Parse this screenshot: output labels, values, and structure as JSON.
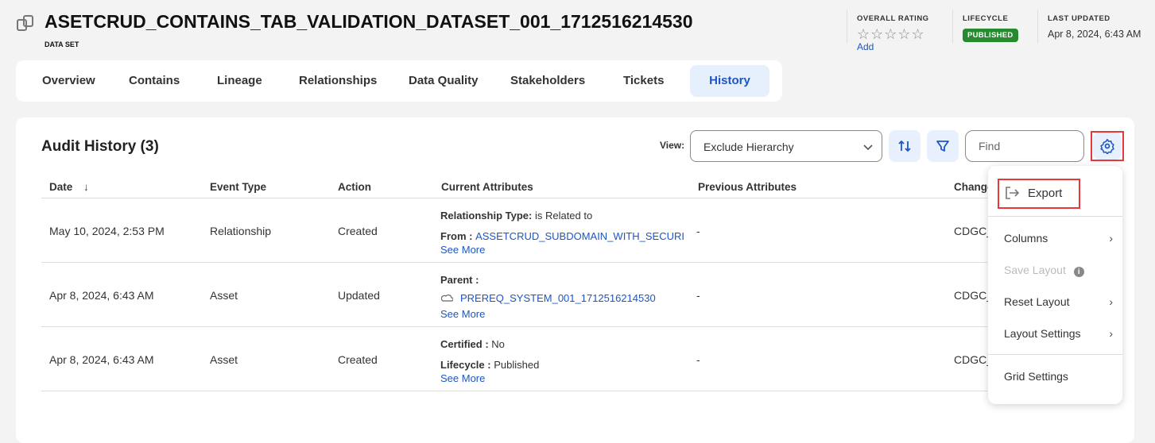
{
  "header": {
    "title": "ASETCRUD_CONTAINS_TAB_VALIDATION_DATASET_001_1712516214530",
    "subtitle": "DATA SET",
    "icon": "dataset-icon"
  },
  "meta": {
    "rating_label": "OVERALL RATING",
    "rating": 0,
    "rating_max": 5,
    "rating_add": "Add",
    "lifecycle_label": "LIFECYCLE",
    "lifecycle": "PUBLISHED",
    "lifecycle_color": "#268a2e",
    "updated_label": "LAST UPDATED",
    "updated": "Apr 8, 2024, 6:43 AM"
  },
  "tabs": [
    {
      "label": "Overview"
    },
    {
      "label": "Contains"
    },
    {
      "label": "Lineage"
    },
    {
      "label": "Relationships"
    },
    {
      "label": "Data Quality"
    },
    {
      "label": "Stakeholders"
    },
    {
      "label": "Tickets"
    },
    {
      "label": "History",
      "active": true
    }
  ],
  "audit": {
    "title": "Audit History (3)",
    "view_label": "View:",
    "view_value": "Exclude Hierarchy",
    "find_placeholder": "Find",
    "columns": [
      "Date",
      "Event Type",
      "Action",
      "Current Attributes",
      "Previous Attributes",
      "Change"
    ],
    "rows": [
      {
        "date": "May 10, 2024, 2:53 PM",
        "event": "Relationship",
        "action": "Created",
        "a1k": "Relationship Type",
        "a1v": "is Related to",
        "a2k": "From",
        "a2v": "ASSETCRUD_SUBDOMAIN_WITH_SECURI",
        "more": "See More",
        "prev": "-",
        "change": "CDGC_"
      },
      {
        "date": "Apr 8, 2024, 6:43 AM",
        "event": "Asset",
        "action": "Updated",
        "a1k": "Parent",
        "a2v": "PREREQ_SYSTEM_001_1712516214530",
        "more": "See More",
        "prev": "-",
        "change": "CDGC_"
      },
      {
        "date": "Apr 8, 2024, 6:43 AM",
        "event": "Asset",
        "action": "Created",
        "a1k": "Certified",
        "a1v": "No",
        "a2k": "Lifecycle",
        "a2v": "Published",
        "more": "See More",
        "prev": "-",
        "change": "CDGC_"
      }
    ]
  },
  "menu": {
    "export": "Export",
    "columns": "Columns",
    "save_layout": "Save Layout",
    "reset_layout": "Reset Layout",
    "layout_settings": "Layout Settings",
    "grid_settings": "Grid Settings"
  },
  "colors": {
    "accent": "#1c56c5",
    "highlight": "#e5383b"
  }
}
